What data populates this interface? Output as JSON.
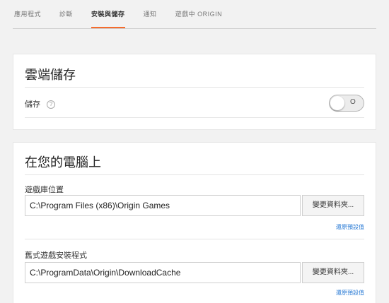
{
  "tabs": [
    {
      "label": "應用程式"
    },
    {
      "label": "診斷"
    },
    {
      "label": "安裝與儲存"
    },
    {
      "label": "通知"
    },
    {
      "label": "遊戲中 ORIGIN"
    }
  ],
  "cloud_storage": {
    "title": "雲端儲存",
    "storage_label": "儲存",
    "help_glyph": "?",
    "toggle_text": "O",
    "toggle_on": false
  },
  "on_computer": {
    "title": "在您的電腦上",
    "game_library": {
      "label": "遊戲庫位置",
      "path": "C:\\Program Files (x86)\\Origin Games",
      "button": "變更資料夾...",
      "restore": "還原預設值"
    },
    "legacy_installer": {
      "label": "舊式遊戲安裝程式",
      "path": "C:\\ProgramData\\Origin\\DownloadCache",
      "button": "變更資料夾...",
      "restore": "還原預設值"
    }
  },
  "colors": {
    "accent": "#f56c2d",
    "link": "#2a7bd5",
    "background": "#f2f2f2"
  }
}
